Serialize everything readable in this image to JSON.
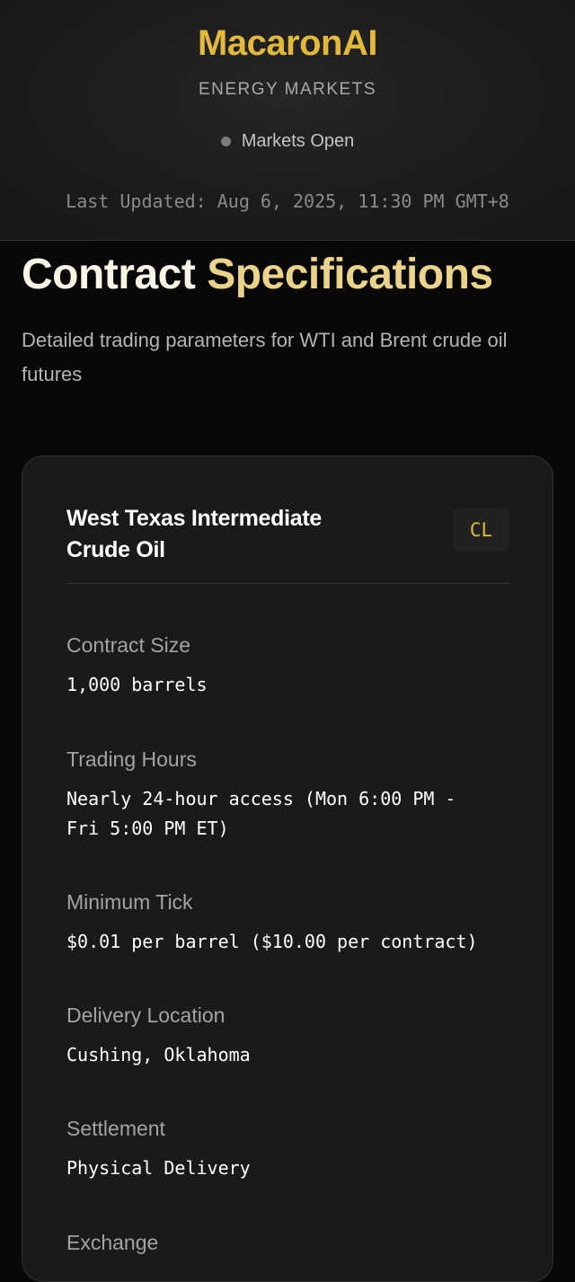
{
  "header": {
    "brand": "MacaronAI",
    "subtitle": "ENERGY MARKETS",
    "status": "Markets Open",
    "last_updated": "Last Updated: Aug 6, 2025, 11:30 PM GMT+8"
  },
  "page": {
    "title_part1": "Contract",
    "title_part2": "Specifications",
    "description": "Detailed trading parameters for WTI and Brent crude oil futures"
  },
  "card": {
    "title": "West Texas Intermediate Crude Oil",
    "symbol": "CL",
    "specs": [
      {
        "label": "Contract Size",
        "value": "1,000 barrels"
      },
      {
        "label": "Trading Hours",
        "value": "Nearly 24-hour access (Mon 6:00 PM -\nFri 5:00 PM ET)"
      },
      {
        "label": "Minimum Tick",
        "value": "$0.01 per barrel ($10.00 per contract)"
      },
      {
        "label": "Delivery Location",
        "value": "Cushing, Oklahoma"
      },
      {
        "label": "Settlement",
        "value": "Physical Delivery"
      },
      {
        "label": "Exchange",
        "value": ""
      }
    ]
  }
}
